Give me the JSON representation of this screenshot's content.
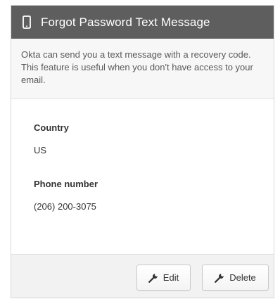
{
  "card": {
    "title": "Forgot Password Text Message",
    "header_icon": "mobile-phone-icon",
    "description": "Okta can send you a text message with a recovery code. This feature is useful when you don't have access to your email.",
    "fields": [
      {
        "label": "Country",
        "value": "US"
      },
      {
        "label": "Phone number",
        "value": "(206) 200-3075"
      }
    ],
    "buttons": {
      "edit_label": "Edit",
      "delete_label": "Delete",
      "icon": "wrench-icon"
    }
  },
  "colors": {
    "header_bg": "#5e5e5e",
    "footer_bg": "#f2f2f2",
    "description_bg": "#f7f7f7"
  }
}
